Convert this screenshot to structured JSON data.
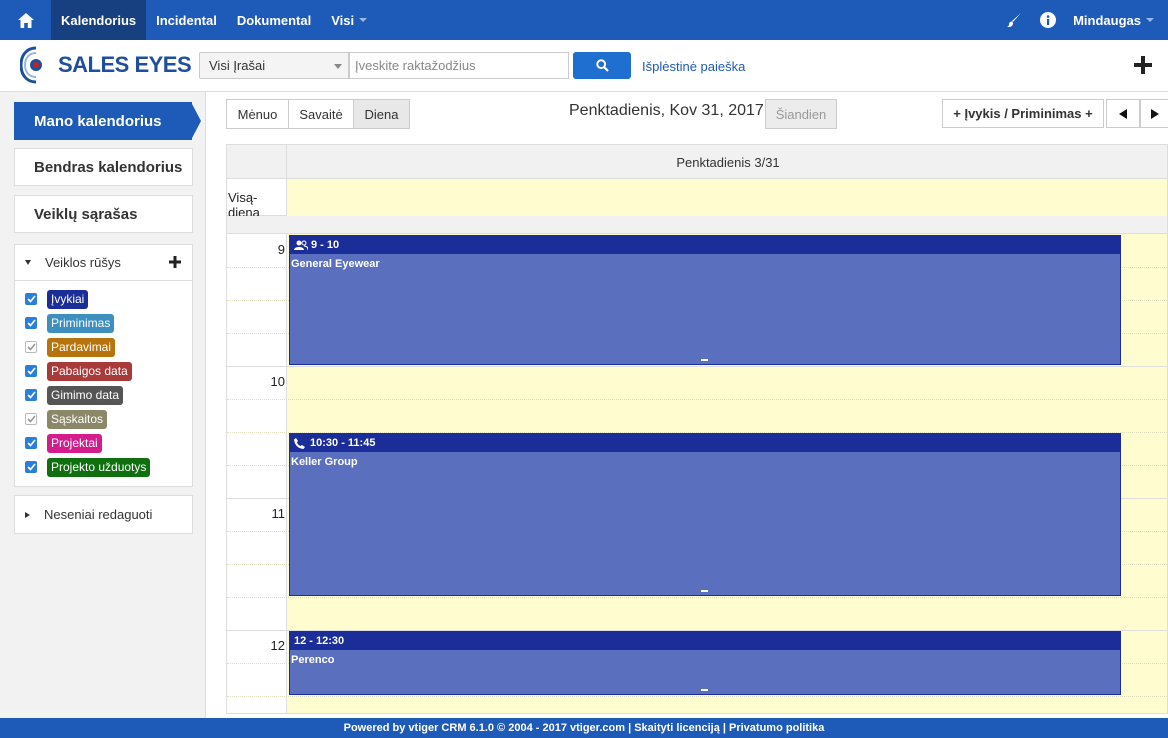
{
  "topnav": {
    "items": [
      {
        "label": "Kalendorius"
      },
      {
        "label": "Incidental"
      },
      {
        "label": "Dokumental"
      },
      {
        "label": "Visi"
      }
    ],
    "user": "Mindaugas"
  },
  "header": {
    "logo": "SALES EYES",
    "scope_select": "Visi Įrašai",
    "search_placeholder": "Įveskite raktažodžius",
    "advanced_search": "Išplėstinė paieška"
  },
  "sidebar": {
    "my_calendar": "Mano kalendorius",
    "shared_calendar": "Bendras kalendorius",
    "activity_list": "Veiklų sąrašas",
    "activity_types_title": "Veiklos rūšys",
    "activity_types": [
      {
        "label": "Įvykiai",
        "color": "#1b2d99",
        "checked": true
      },
      {
        "label": "Priminimas",
        "color": "#3d8fc0",
        "checked": true
      },
      {
        "label": "Pardavimai",
        "color": "#b8740c",
        "checked": false
      },
      {
        "label": "Pabaigos data",
        "color": "#a83a3a",
        "checked": true
      },
      {
        "label": "Gimimo data",
        "color": "#555555",
        "checked": true
      },
      {
        "label": "Sąskaitos",
        "color": "#8a8868",
        "checked": false
      },
      {
        "label": "Projektai",
        "color": "#d41c8c",
        "checked": true
      },
      {
        "label": "Projekto užduotys",
        "color": "#107010",
        "checked": true
      }
    ],
    "recently_edited": "Neseniai redaguoti"
  },
  "calendar": {
    "views": [
      "Mėnuo",
      "Savaitė",
      "Diena"
    ],
    "title": "Penktadienis, Kov 31, 2017",
    "today": "Šiandien",
    "new_event": "+ Įvykis / Priminimas +",
    "day_header": "Penktadienis 3/31",
    "all_day": "Visą-dieną",
    "hours": [
      "9",
      "10",
      "11",
      "12"
    ],
    "events": [
      {
        "time": "9 - 10",
        "title": "General Eyewear",
        "icon": "users-icon",
        "start": 9,
        "end": 10
      },
      {
        "time": "10:30 - 11:45",
        "title": "Keller Group",
        "icon": "phone-icon",
        "start": 10.5,
        "end": 11.75
      },
      {
        "time": "12 - 12:30",
        "title": "Perenco",
        "icon": "",
        "start": 12,
        "end": 12.5
      }
    ]
  },
  "footer": {
    "text": "Powered by vtiger CRM 6.1.0  © 2004 - 2017  vtiger.com | Skaityti licenciją | Privatumo politika"
  }
}
